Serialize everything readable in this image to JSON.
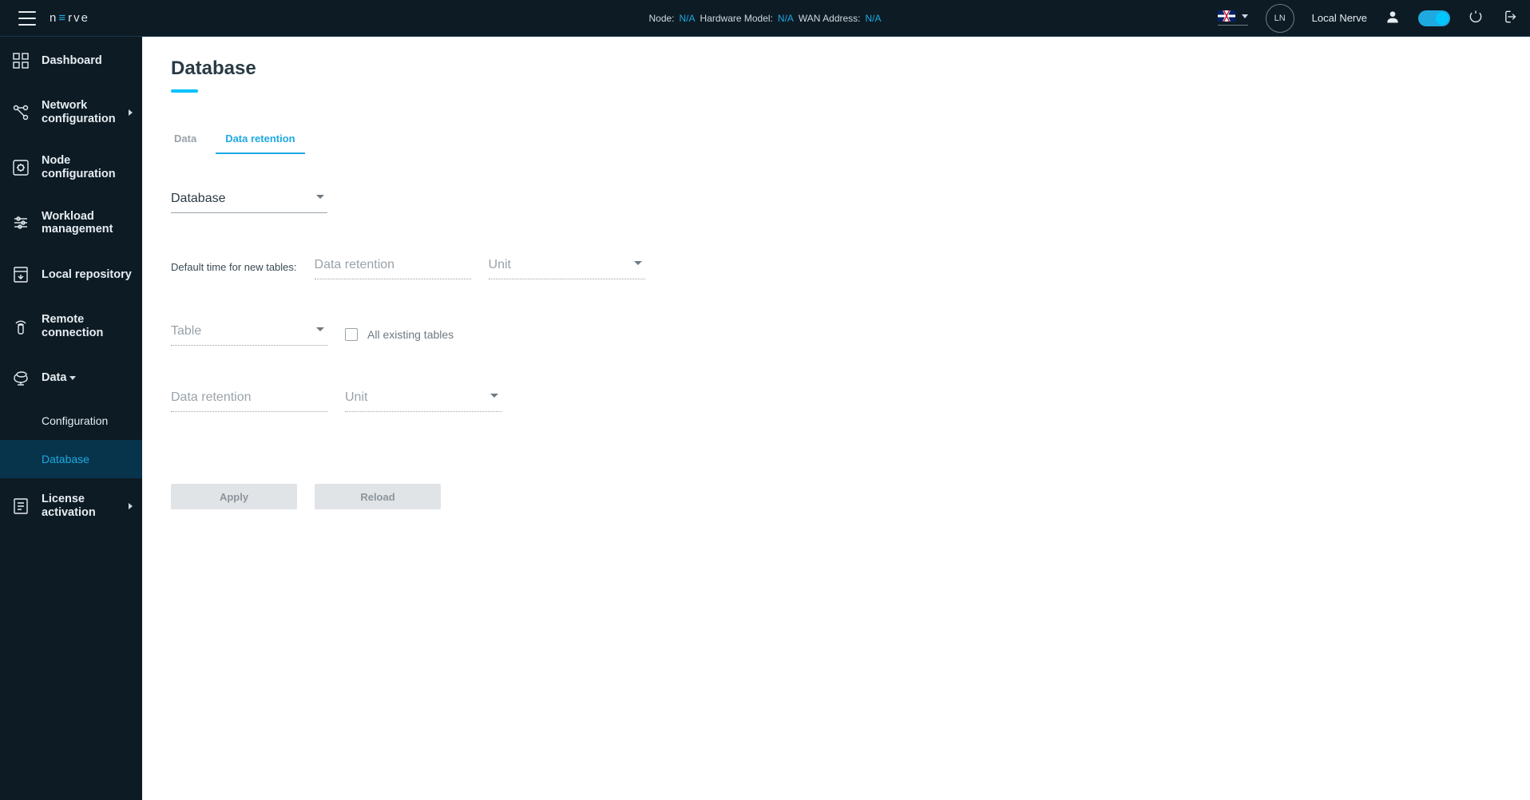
{
  "header": {
    "node_label": "Node:",
    "node_value": "N/A",
    "hw_label": "Hardware Model:",
    "hw_value": "N/A",
    "wan_label": "WAN Address:",
    "wan_value": "N/A",
    "avatar_initials": "LN",
    "local_nerve": "Local Nerve"
  },
  "logo": {
    "pre": "n",
    "mid": "≡",
    "post": "rve"
  },
  "sidebar": {
    "dashboard": "Dashboard",
    "netconf": "Network configuration",
    "nodeconf": "Node configuration",
    "workload": "Workload management",
    "repo": "Local repository",
    "remote": "Remote connection",
    "data": "Data",
    "sub_config": "Configuration",
    "sub_database": "Database",
    "license": "License activation"
  },
  "page": {
    "title": "Database"
  },
  "tabs": {
    "data": "Data",
    "retention": "Data retention"
  },
  "form": {
    "database_label": "Database",
    "default_time_label": "Default time for new tables:",
    "data_retention_placeholder": "Data retention",
    "unit_placeholder": "Unit",
    "table_placeholder": "Table",
    "all_tables_label": "All existing tables"
  },
  "buttons": {
    "apply": "Apply",
    "reload": "Reload"
  }
}
